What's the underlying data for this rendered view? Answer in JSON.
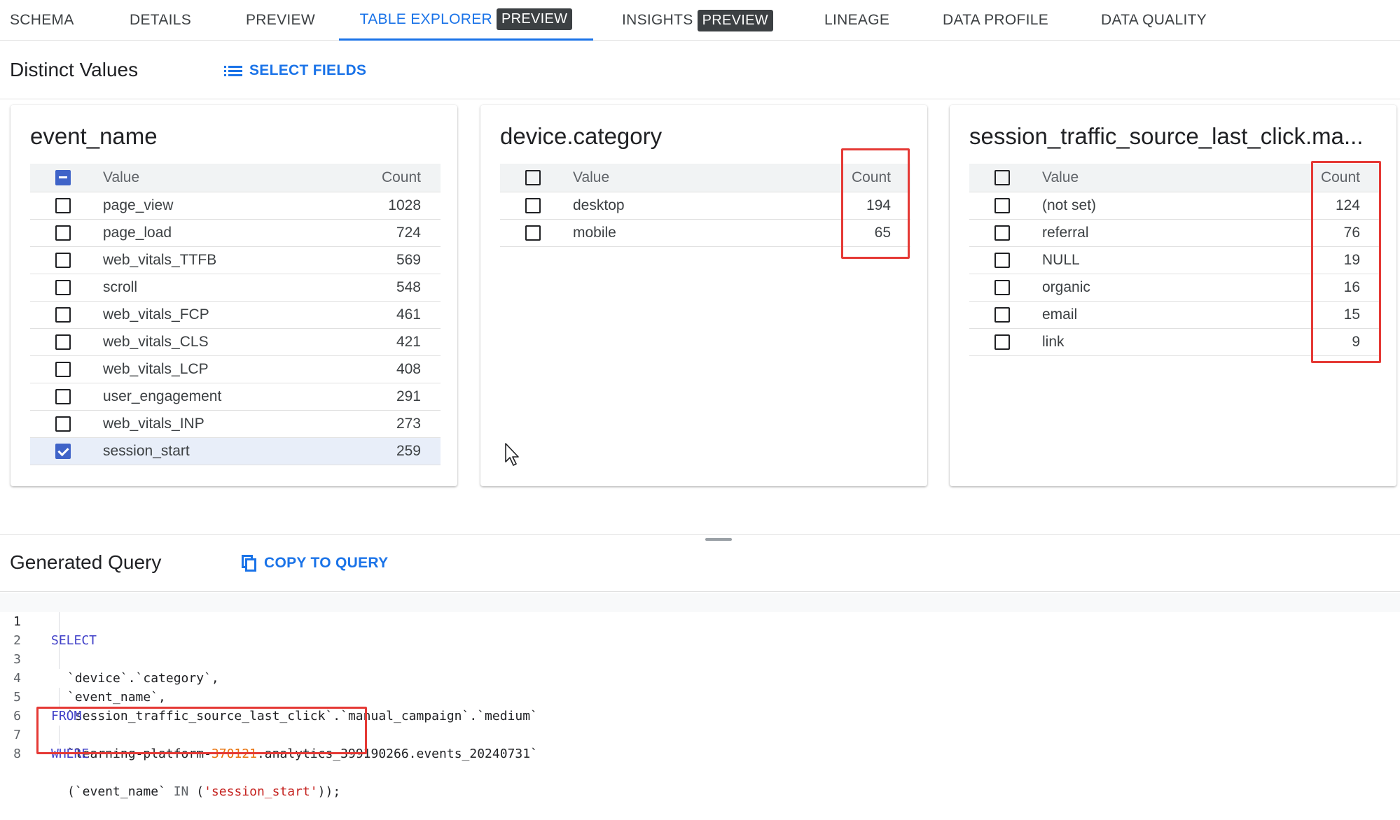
{
  "tabs": [
    {
      "label": "SCHEMA"
    },
    {
      "label": "DETAILS"
    },
    {
      "label": "PREVIEW"
    },
    {
      "label": "TABLE EXPLORER",
      "badge": "PREVIEW"
    },
    {
      "label": "INSIGHTS",
      "badge": "PREVIEW"
    },
    {
      "label": "LINEAGE"
    },
    {
      "label": "DATA PROFILE"
    },
    {
      "label": "DATA QUALITY"
    }
  ],
  "distinct": {
    "title": "Distinct Values",
    "select_fields_label": "SELECT FIELDS"
  },
  "cards": [
    {
      "title": "event_name",
      "col_value": "Value",
      "col_count": "Count",
      "rows": [
        {
          "value": "page_view",
          "count": "1028"
        },
        {
          "value": "page_load",
          "count": "724"
        },
        {
          "value": "web_vitals_TTFB",
          "count": "569"
        },
        {
          "value": "scroll",
          "count": "548"
        },
        {
          "value": "web_vitals_FCP",
          "count": "461"
        },
        {
          "value": "web_vitals_CLS",
          "count": "421"
        },
        {
          "value": "web_vitals_LCP",
          "count": "408"
        },
        {
          "value": "user_engagement",
          "count": "291"
        },
        {
          "value": "web_vitals_INP",
          "count": "273"
        },
        {
          "value": "session_start",
          "count": "259"
        }
      ]
    },
    {
      "title": "device.category",
      "col_value": "Value",
      "col_count": "Count",
      "rows": [
        {
          "value": "desktop",
          "count": "194"
        },
        {
          "value": "mobile",
          "count": "65"
        }
      ]
    },
    {
      "title": "session_traffic_source_last_click.ma...",
      "col_value": "Value",
      "col_count": "Count",
      "rows": [
        {
          "value": "(not set)",
          "count": "124"
        },
        {
          "value": "referral",
          "count": "76"
        },
        {
          "value": "NULL",
          "count": "19"
        },
        {
          "value": "organic",
          "count": "16"
        },
        {
          "value": "email",
          "count": "15"
        },
        {
          "value": "link",
          "count": "9"
        }
      ]
    }
  ],
  "query": {
    "title": "Generated Query",
    "copy_label": "COPY TO QUERY",
    "line_numbers": [
      "1",
      "2",
      "3",
      "4",
      "5",
      "6",
      "7",
      "8"
    ],
    "kw_select": "SELECT",
    "l2": "`device`.`category`,",
    "l3": "`event_name`,",
    "l4": "`session_traffic_source_last_click`.`manual_campaign`.`medium`",
    "kw_from": "FROM",
    "l6_a": "`learning-platform-",
    "l6_num": "370121",
    "l6_b": ".analytics_399190266.events_20240731`",
    "kw_where": "WHERE",
    "l8_a": "(`event_name` ",
    "l8_in": "IN",
    "l8_b": " (",
    "l8_str": "'session_start'",
    "l8_c": "));"
  },
  "colors": {
    "accent": "#1a73e8",
    "highlight": "#e53935",
    "checkbox_checked": "#3f63c8",
    "badge_bg": "#3c4043"
  }
}
